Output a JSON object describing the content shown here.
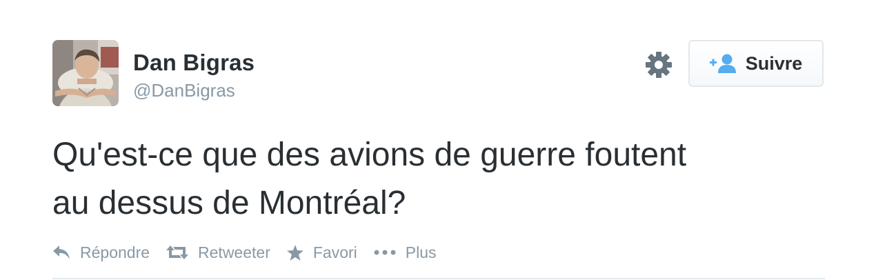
{
  "user": {
    "name": "Dan Bigras",
    "handle": "@DanBigras"
  },
  "follow_button": {
    "label": "Suivre",
    "icon": "add-user-icon"
  },
  "settings": {
    "icon": "gear-icon"
  },
  "tweet": {
    "text_line1": "Qu'est-ce que des avions de guerre foutent",
    "text_line2": "au dessus de Montréal?"
  },
  "actions": {
    "reply": {
      "label": "Répondre",
      "icon": "reply-icon"
    },
    "retweet": {
      "label": "Retweeter",
      "icon": "retweet-icon"
    },
    "favorite": {
      "label": "Favori",
      "icon": "star-icon"
    },
    "more": {
      "label": "Plus",
      "icon": "more-dots-icon"
    }
  },
  "colors": {
    "text": "#292f33",
    "muted": "#8899a6",
    "border": "#e1e8ed",
    "accent": "#55acee"
  }
}
